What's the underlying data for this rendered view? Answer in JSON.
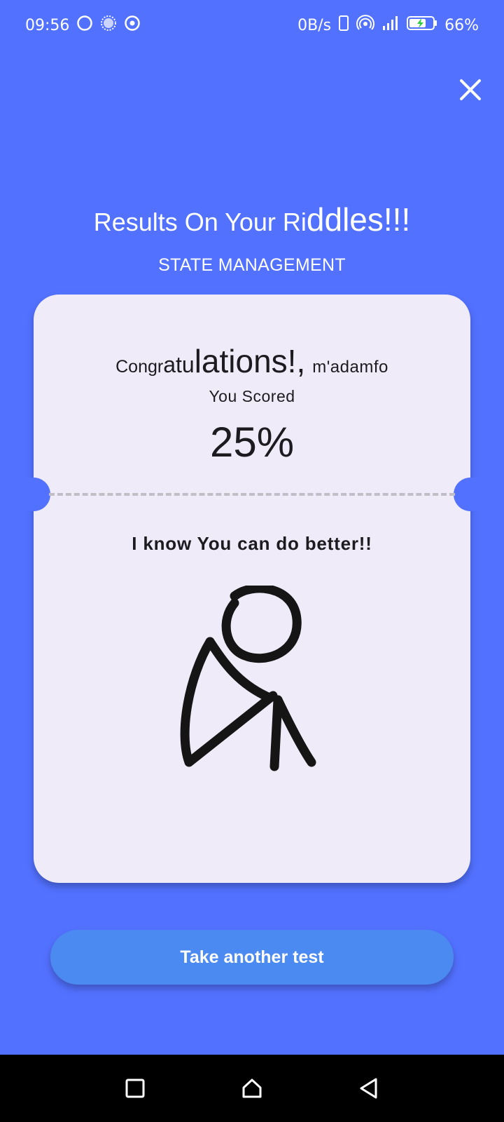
{
  "status_bar": {
    "time": "09:56",
    "net_speed": "0B/s",
    "battery_percent": "66%",
    "left_icons": [
      "circle-icon",
      "sun-icon",
      "target-icon"
    ],
    "right_icons": [
      "phone-outline-icon",
      "hotspot-icon",
      "signal-icon",
      "battery-charging-icon"
    ]
  },
  "header": {
    "title_part_small": "Results On Your Ri",
    "title_part_big": "ddles!!!",
    "subtitle": "STATE MANAGEMENT"
  },
  "result_card": {
    "congrats_a": "Congr",
    "congrats_b": "atu",
    "congrats_c": "lations!,",
    "username": "m'adamfo",
    "you_scored_label": "You Scored",
    "score": "25%",
    "message": "I know You can do better!!",
    "illustration": "sad-stick-figure-icon"
  },
  "actions": {
    "take_another_test_label": "Take another test"
  },
  "nav_bar": {
    "buttons": [
      "recents-square-icon",
      "home-icon",
      "back-triangle-icon"
    ]
  },
  "colors": {
    "background": "#5271ff",
    "card": "#efebf8",
    "button": "#4b8af0",
    "text_dark": "#1c1b1f"
  }
}
